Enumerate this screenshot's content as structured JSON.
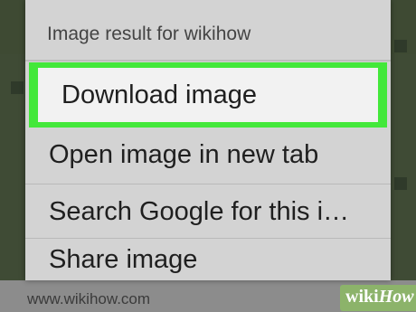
{
  "dialog": {
    "title": "Image result for wikihow",
    "items": [
      {
        "label": "Download image",
        "highlighted": true
      },
      {
        "label": "Open image in new tab"
      },
      {
        "label": "Search Google for this i…"
      },
      {
        "label": "Share image"
      }
    ]
  },
  "background": {
    "url_text": "www.wikihow.com"
  },
  "watermark": {
    "wiki": "wiki",
    "how": "How"
  },
  "colors": {
    "highlight_frame": "#43e83a",
    "dialog_bg": "#d3d3d3"
  }
}
